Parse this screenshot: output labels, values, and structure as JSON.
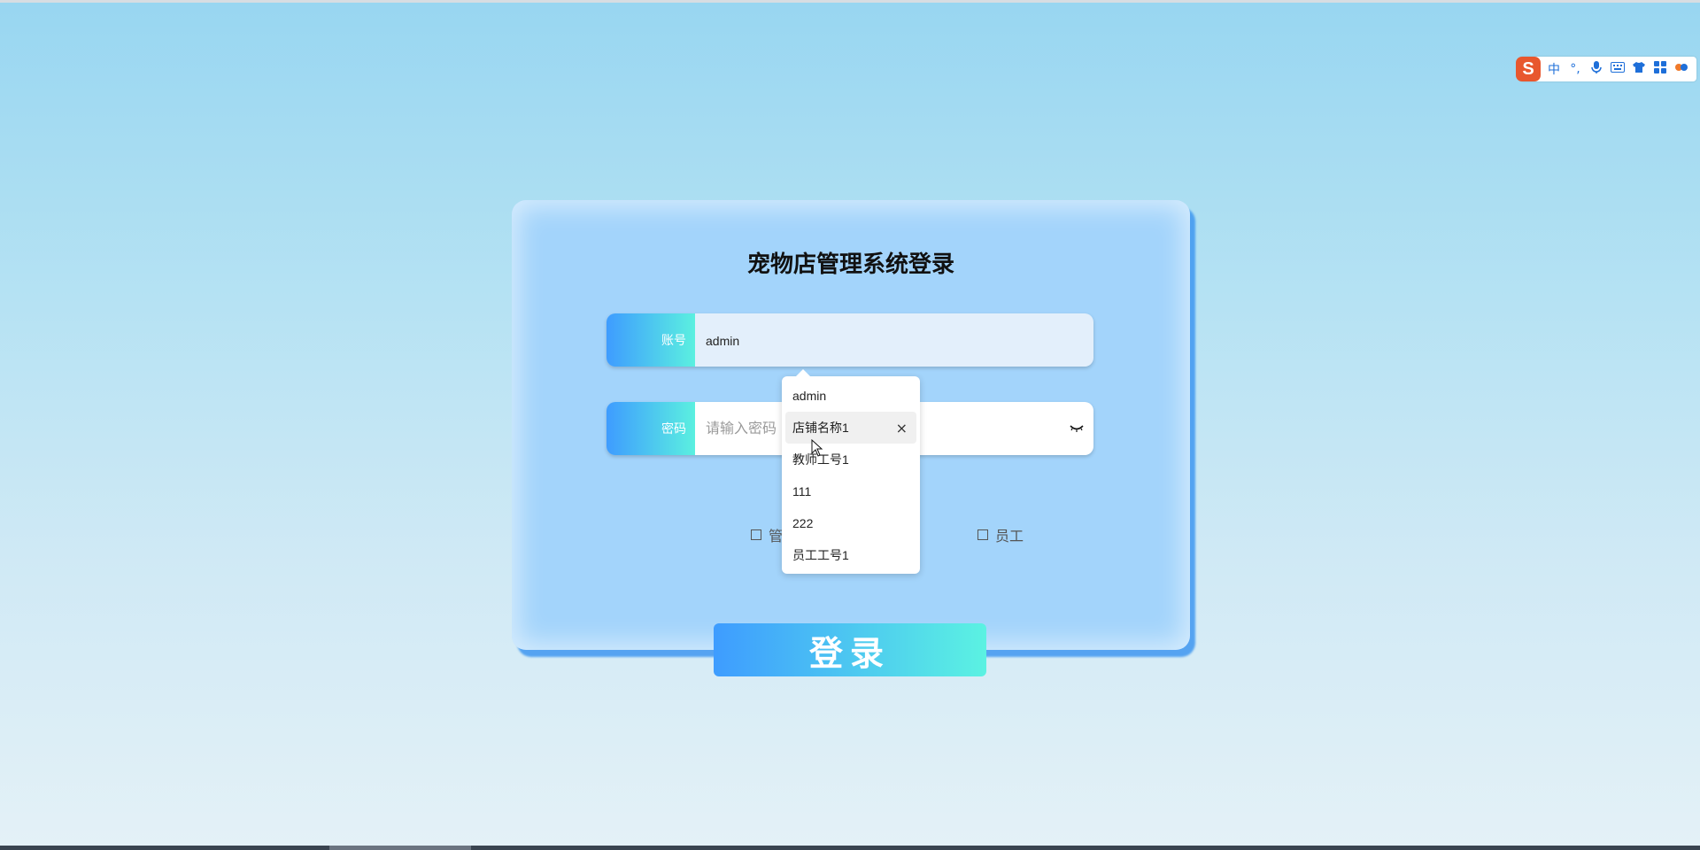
{
  "ime": {
    "logo": "S",
    "items": [
      "中",
      "°,",
      "🎤",
      "⌨",
      "👕",
      "▦",
      "⚙"
    ]
  },
  "login": {
    "title": "宠物店管理系统登录",
    "account_label": "账号",
    "account_value": "admin",
    "password_label": "密码",
    "password_placeholder": "请输入密码",
    "roles": [
      {
        "label": "管理员",
        "checked": false
      },
      {
        "label": "员工",
        "checked": false
      }
    ],
    "role_admin_visible": "管",
    "role_staff": "员工",
    "submit_label": "登录"
  },
  "autocomplete": {
    "items": [
      "admin",
      "店铺名称1",
      "教师工号1",
      "111",
      "222",
      "员工工号1"
    ],
    "active_index": 1,
    "remove_icon": "×"
  },
  "colors": {
    "accent_start": "#3e9cff",
    "accent_end": "#5bf0e0",
    "card_bg": "#a3d4fb"
  }
}
